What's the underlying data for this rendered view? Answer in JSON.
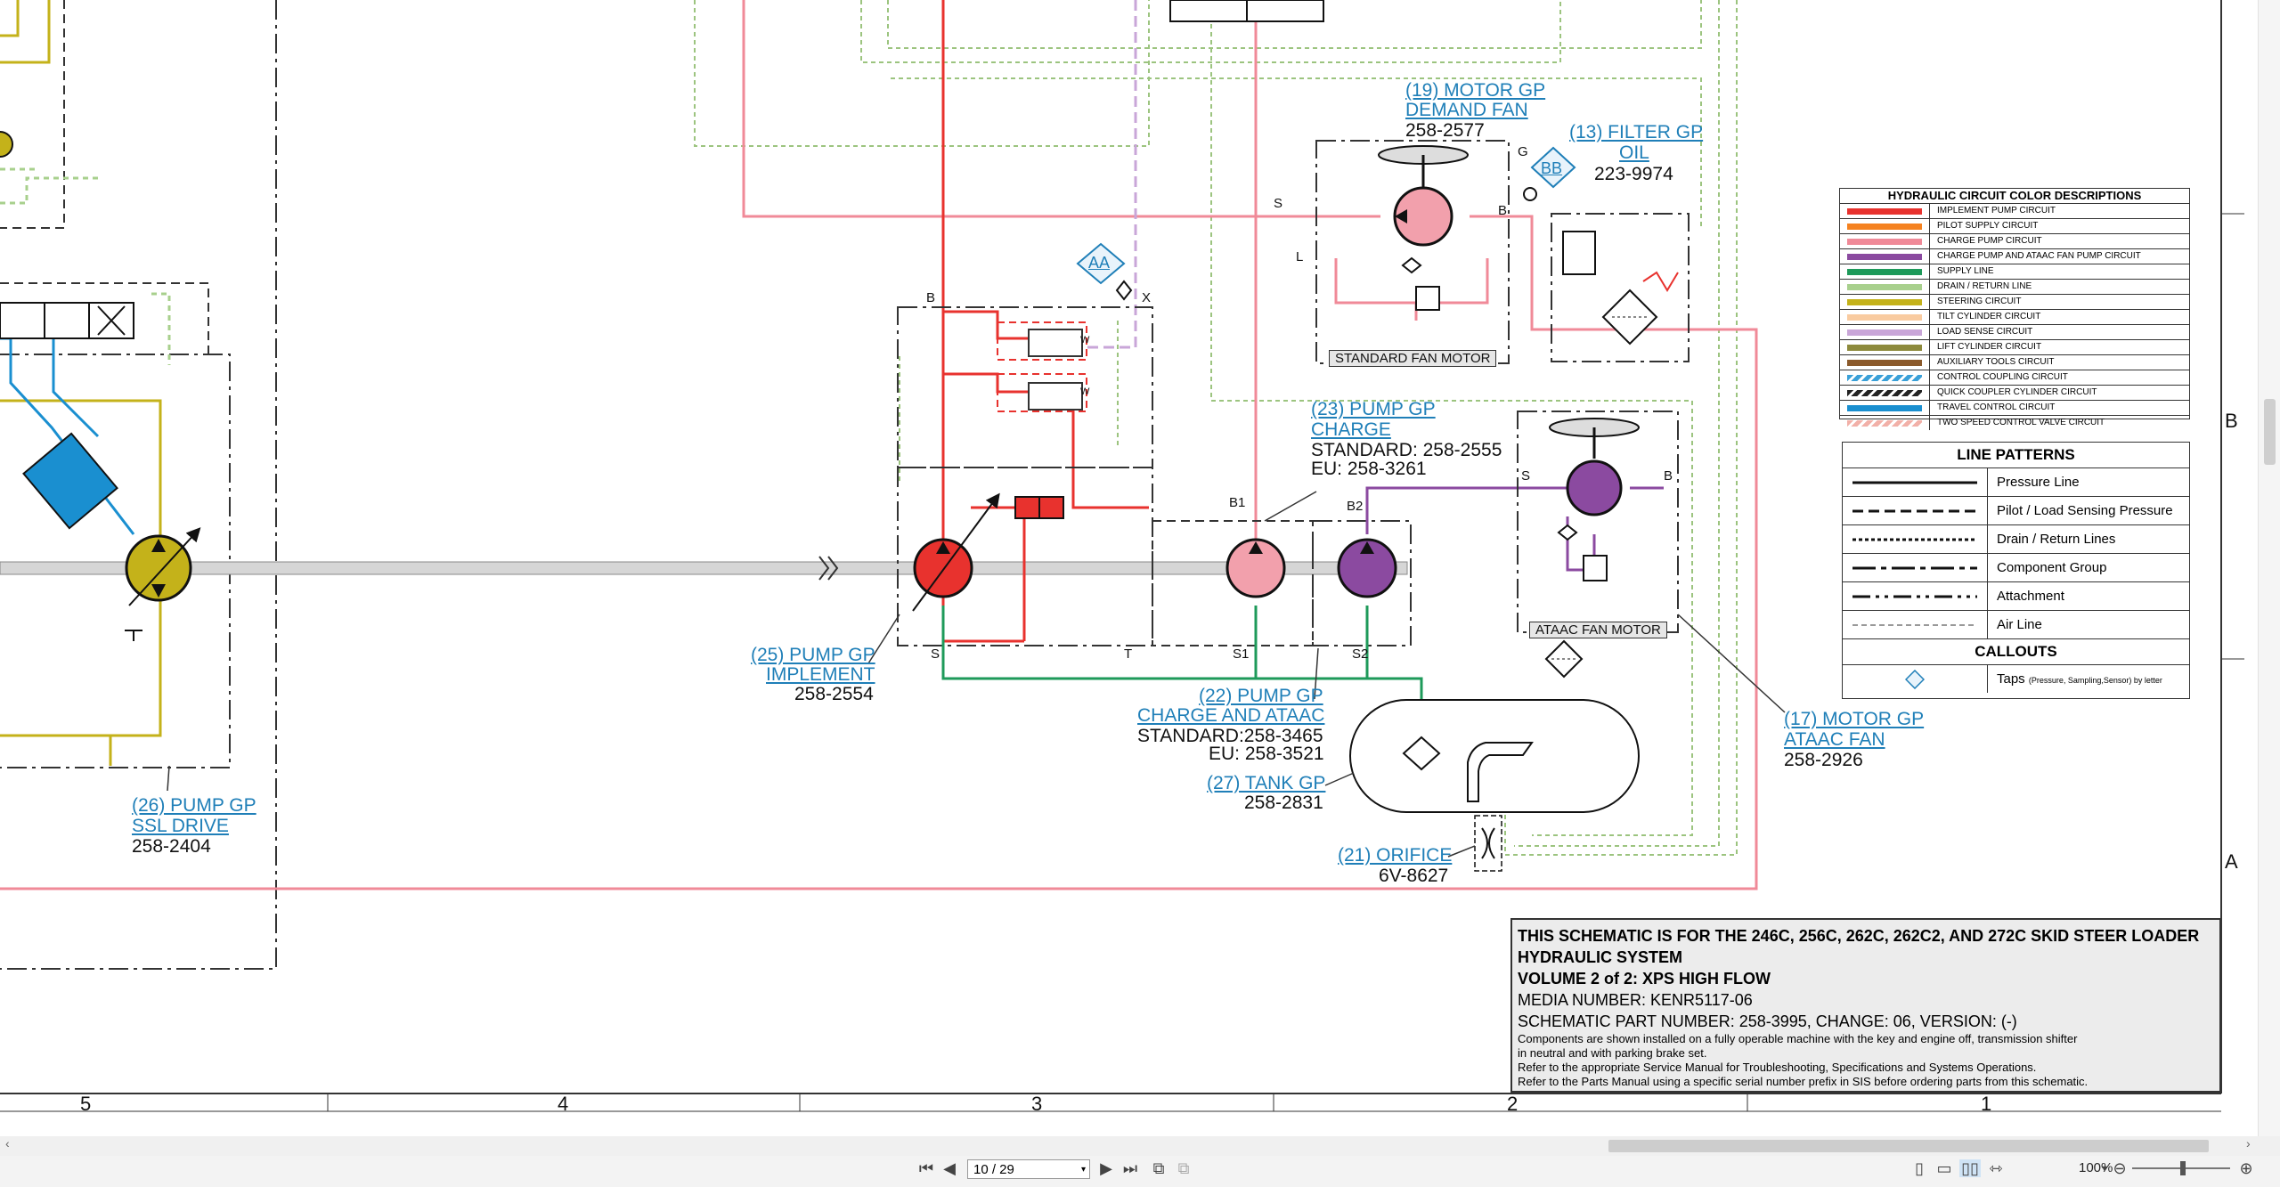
{
  "components": {
    "pump_implement": {
      "callout": "(25) PUMP GP",
      "name": "IMPLEMENT",
      "part": "258-2554"
    },
    "pump_ssl": {
      "callout": "(26) PUMP GP",
      "name": "SSL DRIVE",
      "part": "258-2404"
    },
    "pump_charge_ataac": {
      "callout": "(22) PUMP GP",
      "name": "CHARGE AND ATAAC",
      "part1": "STANDARD:258-3465",
      "part2": "EU: 258-3521"
    },
    "pump_charge": {
      "callout": "(23) PUMP GP",
      "name": "CHARGE",
      "part1": "STANDARD: 258-2555",
      "part2": "EU: 258-3261"
    },
    "motor_demand_fan": {
      "callout": "(19) MOTOR GP",
      "name": "DEMAND FAN",
      "part": "258-2577"
    },
    "filter_oil": {
      "callout": "(13) FILTER GP",
      "name": "OIL",
      "part": "223-9974"
    },
    "tank": {
      "callout": "(27) TANK GP",
      "part": "258-2831"
    },
    "orifice": {
      "callout": "(21) ORIFICE",
      "part": "6V-8627"
    },
    "motor_ataac_fan": {
      "callout": "(17) MOTOR GP",
      "name": "ATAAC FAN",
      "part": "258-2926"
    }
  },
  "labels": {
    "standard_fan_motor": "STANDARD FAN MOTOR",
    "ataac_fan_motor": "ATAAC FAN MOTOR",
    "tap_aa": "AA",
    "tap_bb": "BB",
    "port_B": "B",
    "port_X": "X",
    "port_S": "S",
    "port_T": "T",
    "port_B1": "B1",
    "port_B2": "B2",
    "port_S1": "S1",
    "port_S2": "S2",
    "port_G": "G",
    "port_L": "L",
    "valve_W": "W"
  },
  "color_legend": {
    "title": "HYDRAULIC CIRCUIT COLOR DESCRIPTIONS",
    "items": [
      {
        "label": "IMPLEMENT PUMP CIRCUIT",
        "color": "#e8322e"
      },
      {
        "label": "PILOT SUPPLY CIRCUIT",
        "color": "#f58220"
      },
      {
        "label": "CHARGE PUMP CIRCUIT",
        "color": "#f08a98"
      },
      {
        "label": "CHARGE PUMP AND ATAAC FAN PUMP CIRCUIT",
        "color": "#8b4aa0"
      },
      {
        "label": "SUPPLY LINE",
        "color": "#1e9a5a"
      },
      {
        "label": "DRAIN / RETURN LINE",
        "color": "#a8d08d"
      },
      {
        "label": "STEERING CIRCUIT",
        "color": "#c4b21a"
      },
      {
        "label": "TILT CYLINDER CIRCUIT",
        "color": "#f9cba0"
      },
      {
        "label": "LOAD SENSE CIRCUIT",
        "color": "#c9a6d8"
      },
      {
        "label": "LIFT CYLINDER CIRCUIT",
        "color": "#8d8a3c"
      },
      {
        "label": "AUXILIARY TOOLS CIRCUIT",
        "color": "#8b5a2b"
      },
      {
        "label": "CONTROL COUPLING CIRCUIT",
        "color": "#3aa0d8"
      },
      {
        "label": "QUICK COUPLER CYLINDER CIRCUIT",
        "color": "#222222"
      },
      {
        "label": "TRAVEL CONTROL CIRCUIT",
        "color": "#1a8fd0"
      },
      {
        "label": "TWO SPEED CONTROL VALVE CIRCUIT",
        "color": "#f2b0a8"
      }
    ]
  },
  "pattern_legend": {
    "title": "LINE PATTERNS",
    "items": [
      "Pressure Line",
      "Pilot / Load Sensing Pressure",
      "Drain / Return Lines",
      "Component Group",
      "Attachment",
      "Air Line"
    ],
    "callouts_title": "CALLOUTS",
    "taps_label": "Taps",
    "taps_note": "(Pressure, Sampling,Sensor) by letter"
  },
  "title_block": {
    "line1": "THIS SCHEMATIC IS FOR THE 246C, 256C, 262C, 262C2, AND 272C SKID STEER LOADER",
    "line2": "HYDRAULIC SYSTEM",
    "line3": "VOLUME 2 of 2: XPS HIGH FLOW",
    "line4": "MEDIA NUMBER: KENR5117-06",
    "line5": "SCHEMATIC PART NUMBER: 258-3995, CHANGE: 06, VERSION: (-)",
    "note1": "Components are shown installed on a fully operable machine with the key and engine off, transmission shifter",
    "note2": "in neutral and with parking brake set.",
    "note3": "Refer to the appropriate Service Manual for Troubleshooting, Specifications and Systems Operations.",
    "note4": "Refer to the Parts Manual using a specific serial number prefix in SIS before ordering parts from this schematic."
  },
  "frame": {
    "columns": [
      "5",
      "4",
      "3",
      "2",
      "1"
    ],
    "rows": [
      "B",
      "A"
    ]
  },
  "viewer": {
    "page": "10 / 29",
    "zoom": "100%"
  }
}
